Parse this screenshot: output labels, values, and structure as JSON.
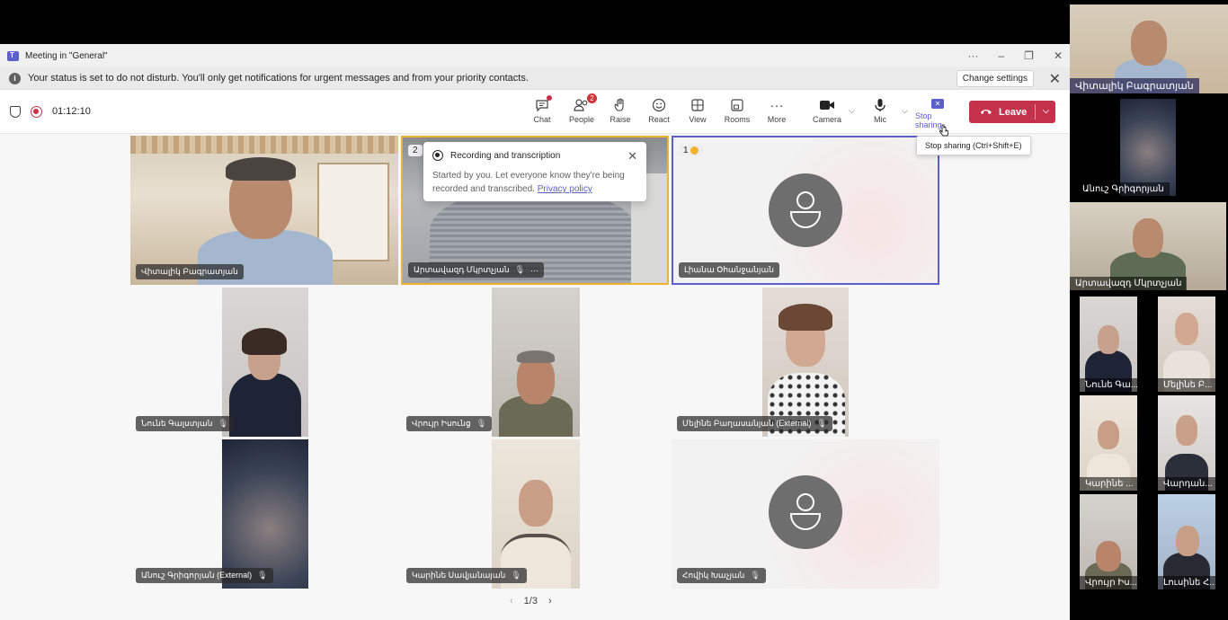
{
  "window": {
    "title": "Meeting in \"General\"",
    "controls": {
      "more": "···",
      "minimize": "–",
      "restore": "❐",
      "close": "✕"
    }
  },
  "banner": {
    "message": "Your status is set to do not disturb. You'll only get notifications for urgent messages and from your priority contacts.",
    "change_settings": "Change settings",
    "close": "✕"
  },
  "toolbar": {
    "timer": "01:12:10",
    "buttons": [
      {
        "label": "Chat",
        "icon": "chat-icon"
      },
      {
        "label": "People",
        "icon": "people-icon",
        "badge": "2"
      },
      {
        "label": "Raise",
        "icon": "hand-icon"
      },
      {
        "label": "React",
        "icon": "smile-icon"
      },
      {
        "label": "View",
        "icon": "grid-icon"
      },
      {
        "label": "Rooms",
        "icon": "rooms-icon"
      },
      {
        "label": "More",
        "icon": "more-icon"
      },
      {
        "label": "Camera",
        "icon": "camera-icon"
      },
      {
        "label": "Mic",
        "icon": "mic-icon"
      },
      {
        "label": "Stop sharing",
        "icon": "stop-share-icon"
      }
    ],
    "leave": "Leave",
    "tooltip": "Stop sharing (Ctrl+Shift+E)"
  },
  "recording_popup": {
    "title": "Recording and transcription",
    "body": "Started by you. Let everyone know they're being recorded and transcribed.",
    "link": "Privacy policy"
  },
  "tiles": {
    "t1": {
      "name": "Վիտալիկ Բագրատյան"
    },
    "t2": {
      "name": "Արտավազդ Մկրտչյան",
      "number": "2"
    },
    "t3": {
      "name": "Լիանա Օհանջանյան",
      "number": "1"
    },
    "t4": {
      "name": "Նունե Գալստյան"
    },
    "t5": {
      "name": "Վրույր Իսունց"
    },
    "t6": {
      "name": "Մելինե Բաղասանյան (External)"
    },
    "t7": {
      "name": "Անուշ Գրիգորյան (External)"
    },
    "t8": {
      "name": "Կարինե Սավյանայան"
    },
    "t9": {
      "name": "Հովիկ Խաչյան"
    }
  },
  "pager": {
    "prev": "‹",
    "label": "1/3",
    "next": "›"
  },
  "side": {
    "s1": "Վիտալիկ Բագրատյան",
    "s2": "Անուշ Գրիգորյան",
    "s3": "Արտավազդ Մկրտչյան",
    "s4": "Նունե Գա...",
    "s5": "Մելինե Բ...",
    "s6": "Կարինե ...",
    "s7": "Վարդան...",
    "s8": "Վրույր Իս...",
    "s9": "Լուսինե Հ..."
  },
  "colors": {
    "accent": "#5b5fc7",
    "leave": "#c4314b",
    "speaking_border": "#f2b22e"
  }
}
